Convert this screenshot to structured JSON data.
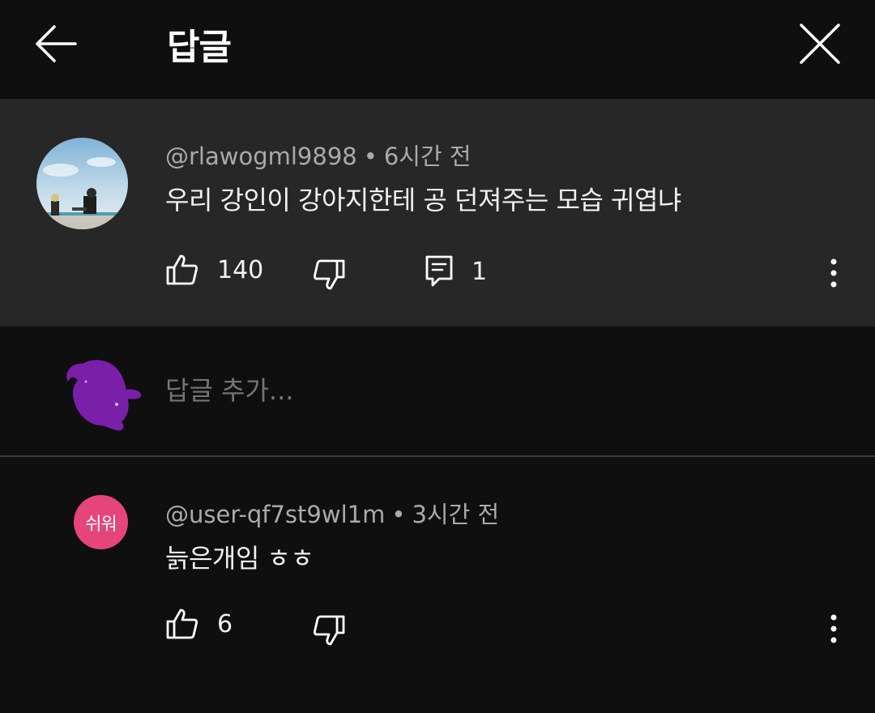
{
  "header": {
    "title": "답글",
    "back_icon": "arrow-left-icon",
    "close_icon": "close-icon"
  },
  "parent_comment": {
    "author": "@rlawogml9898",
    "separator": "•",
    "time": "6시간 전",
    "text": "우리 강인이 강아지한테 공 던져주는 모습 귀엽냐",
    "likes": "140",
    "replies": "1"
  },
  "add_reply": {
    "placeholder": "답글 추가..."
  },
  "reply_comment": {
    "author": "@user-qf7st9wl1m",
    "separator": "•",
    "time": "3시간 전",
    "text": "늙은개임 ㅎㅎ",
    "likes": "6",
    "avatar_text": "쉬워",
    "avatar_color": "#e5457a"
  },
  "colors": {
    "background": "#0f0f0f",
    "panel": "#272727",
    "text_primary": "#f1f1f1",
    "text_secondary": "#aaaaaa"
  }
}
